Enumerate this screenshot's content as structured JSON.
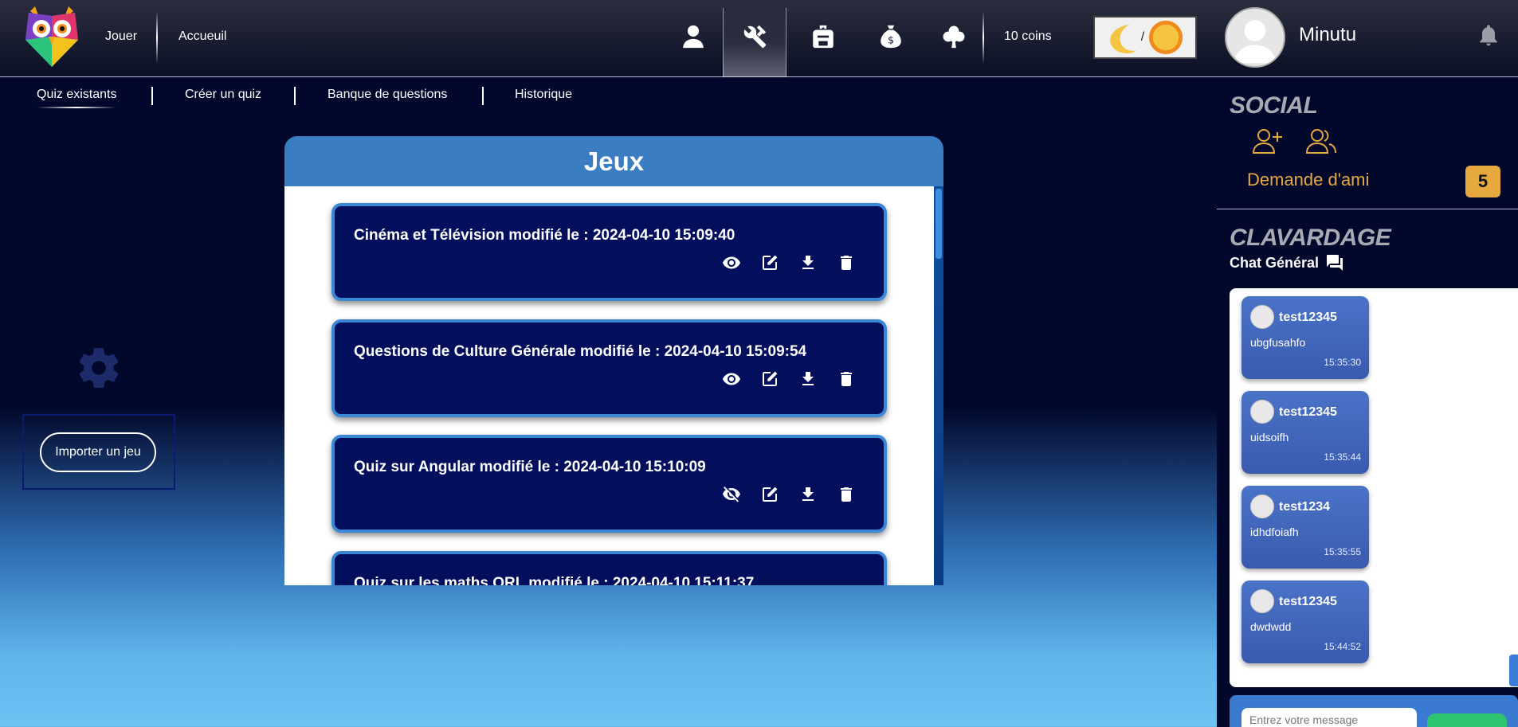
{
  "topbar": {
    "nav": [
      "Jouer",
      "Accueuil"
    ],
    "coins": "10 coins",
    "theme_separator": "/"
  },
  "subnav": [
    "Quiz existants",
    "Créer un quiz",
    "Banque de questions",
    "Historique"
  ],
  "left": {
    "import_label": "Importer un jeu"
  },
  "games": {
    "header": "Jeux",
    "items": [
      {
        "title": "Cinéma et Télévision modifié le : 2024-04-10 15:09:40",
        "visible": true
      },
      {
        "title": "Questions de Culture Générale modifié le : 2024-04-10 15:09:54",
        "visible": true
      },
      {
        "title": "Quiz sur Angular modifié le : 2024-04-10 15:10:09",
        "visible": false
      },
      {
        "title": "Quiz sur les maths ORL modifié le : 2024-04-10 15:11:37",
        "visible": true
      }
    ]
  },
  "profile": {
    "username": "Minutu"
  },
  "social": {
    "title": "SOCIAL",
    "friend_request_label": "Demande d'ami",
    "friend_request_count": "5"
  },
  "chat": {
    "title": "CLAVARDAGE",
    "channel": "Chat Général",
    "messages": [
      {
        "user": "test12345",
        "text": "ubgfusahfo",
        "time": "15:35:30"
      },
      {
        "user": "test12345",
        "text": "uidsoifh",
        "time": "15:35:44"
      },
      {
        "user": "test1234",
        "text": "idhdfoiafh",
        "time": "15:35:55"
      },
      {
        "user": "test12345",
        "text": "dwdwdd",
        "time": "15:44:52"
      }
    ],
    "input_placeholder": "Entrez votre message"
  },
  "colors": {
    "accent": "#3a7dc2",
    "card_bg": "#030e5c",
    "social_accent": "#e6a940"
  }
}
